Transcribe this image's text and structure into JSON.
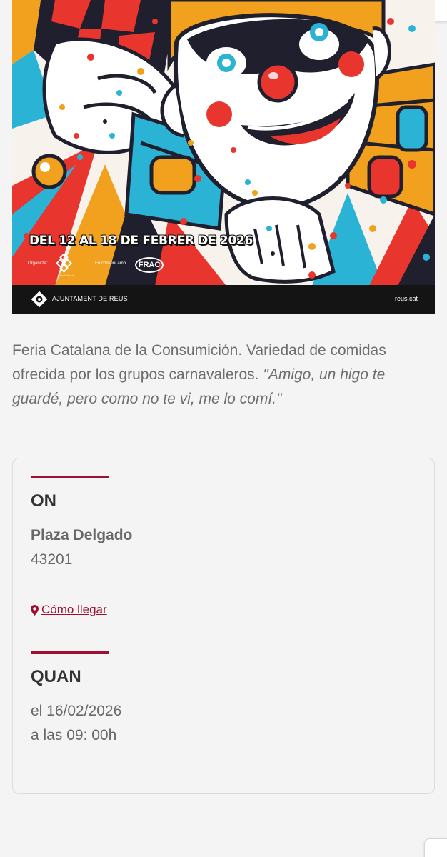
{
  "poster": {
    "date_text": "DEL 12 AL 18 DE FEBRER DE 2026",
    "organitza_label": "Organitza:",
    "organitza_logo_label": "ReusCultura",
    "conveni_label": "En conveni amb",
    "conveni_logo": "FRAC",
    "footer_name": "AJUNTAMENT DE REUS",
    "footer_site": "reus.cat"
  },
  "description": {
    "text": "Feria Catalana de la Consumición. Variedad de comidas ofrecida por los grupos carnavaleros. ",
    "quote": "\"Amigo, un higo te guardé, pero como no te vi, me lo comí.\""
  },
  "where": {
    "heading": "ON",
    "place": "Plaza Delgado",
    "zip": "43201",
    "route_label": " Cómo llegar",
    "route_icon": "map-marker-icon"
  },
  "when": {
    "heading": "QUAN",
    "date": "el 16/02/2026",
    "time": "a las 09: 00h"
  },
  "colors": {
    "accent": "#9d1030",
    "text": "#686868",
    "heading": "#333333",
    "background": "#f4f4f4"
  }
}
